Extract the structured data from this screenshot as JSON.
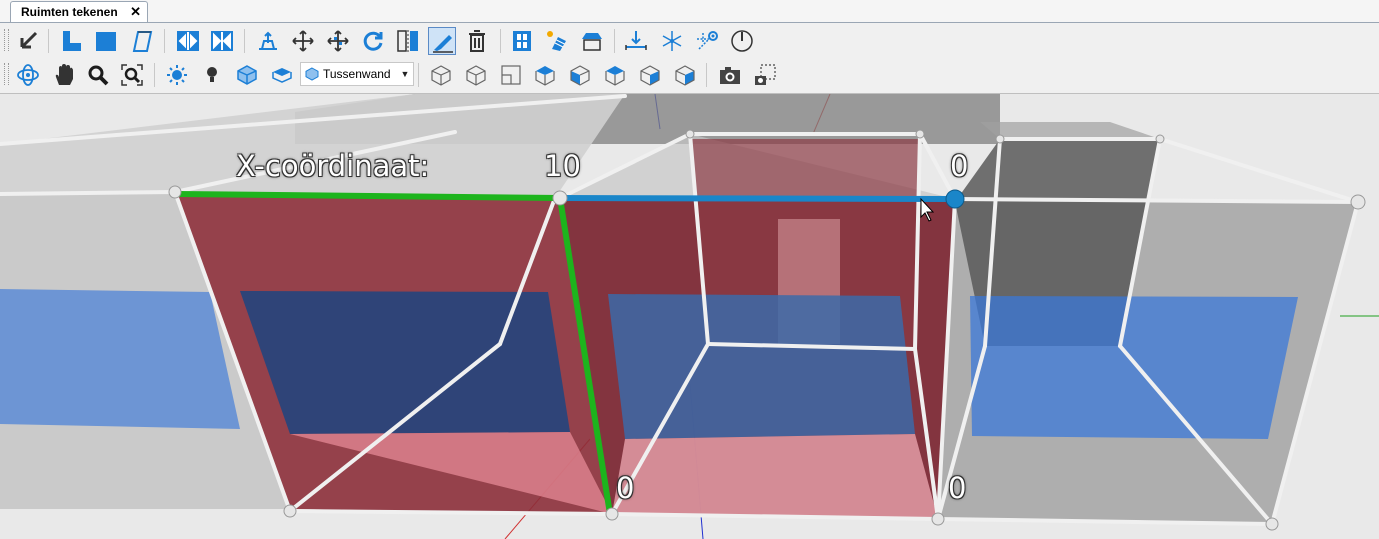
{
  "tab": {
    "title": "Ruimten tekenen",
    "close_glyph": "✕"
  },
  "toolbar1": {
    "buttons": [
      "select-arrow-icon",
      "l-shape-room-icon",
      "rectangle-room-icon",
      "polygon-room-icon",
      "split-horizontal-icon",
      "split-vertical-icon",
      "insert-point-icon",
      "move-icon",
      "move-points-icon",
      "rotate-icon",
      "mirror-icon",
      "edit-wall-icon",
      "delete-icon",
      "window-icon",
      "solar-panel-icon",
      "roof-icon",
      "dimension-icon",
      "snap-icon",
      "snap-settings-icon",
      "angle-icon"
    ],
    "active_button": "edit-wall-icon"
  },
  "toolbar2": {
    "buttons": [
      "orbit-icon",
      "pan-hand-icon",
      "zoom-icon",
      "zoom-extents-icon",
      "light-sun-icon",
      "light-bulb-icon",
      "show-walls-icon",
      "show-floors-icon",
      "view-iso-1-icon",
      "view-iso-2-icon",
      "view-plan-icon",
      "view-box-1-icon",
      "view-box-2-icon",
      "view-box-3-icon",
      "view-box-4-icon",
      "view-box-5-icon",
      "camera-icon",
      "screenshot-region-icon"
    ],
    "wall_type": {
      "selected": "Tussenwand"
    }
  },
  "viewport": {
    "coordinate_label": "X-coördinaat:",
    "labels": {
      "top_mid": "10",
      "top_right": "0",
      "bottom_mid": "0",
      "bottom_right": "0"
    },
    "colors": {
      "green_edge": "#1db41d",
      "blue_edge": "#1a86c9",
      "red_wall": "#a0303c",
      "blue_floor": "#3a6fd0"
    }
  }
}
